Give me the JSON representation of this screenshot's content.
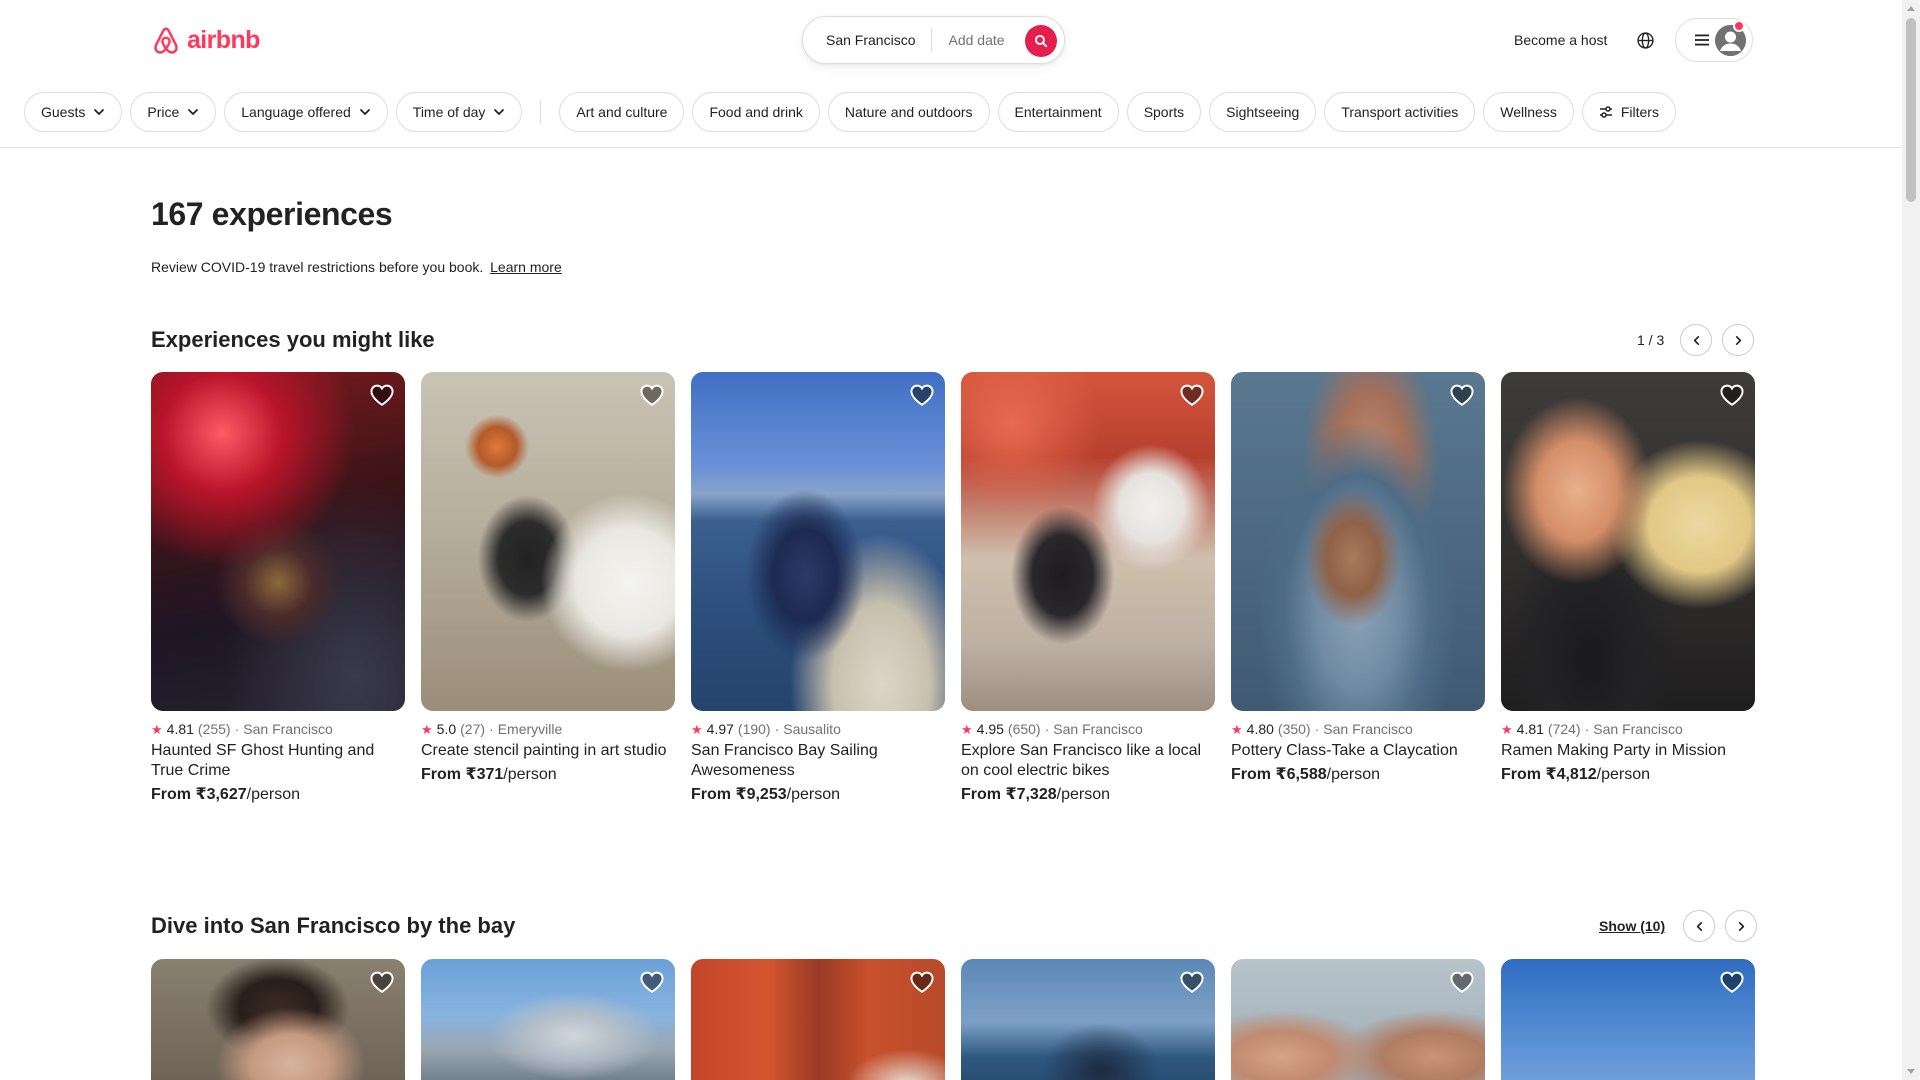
{
  "brand": {
    "name": "airbnb",
    "color": "#ff385c"
  },
  "search": {
    "location": "San Francisco",
    "date_placeholder": "Add date",
    "button_icon": "search-icon",
    "button_color": "#e61e4d"
  },
  "header_actions": {
    "host_label": "Become a host",
    "globe_icon": "globe-icon",
    "menu_icon": "hamburger-icon",
    "avatar_icon": "user-avatar-icon",
    "notification_color": "#ff385c"
  },
  "filters": {
    "dropdowns": [
      "Guests",
      "Price",
      "Language offered",
      "Time of day"
    ],
    "categories": [
      "Art and culture",
      "Food and drink",
      "Nature and outdoors",
      "Entertainment",
      "Sports",
      "Sightseeing",
      "Transport activities",
      "Wellness"
    ],
    "filters_label": "Filters"
  },
  "main": {
    "title": "167 experiences",
    "covid_notice": "Review COVID-19 travel restrictions before you book.",
    "covid_link": "Learn more"
  },
  "sections": [
    {
      "title": "Experiences you might like",
      "pager": "1 / 3",
      "cards": [
        {
          "rating": "4.81",
          "reviews": "(255)",
          "location": "San Francisco",
          "title": "Haunted SF Ghost Hunting and True Crime",
          "price_prefix": "From",
          "price": "₹3,627",
          "price_suffix": "/person"
        },
        {
          "rating": "5.0",
          "reviews": "(27)",
          "location": "Emeryville",
          "title": "Create stencil painting in art studio",
          "price_prefix": "From",
          "price": "₹371",
          "price_suffix": "/person"
        },
        {
          "rating": "4.97",
          "reviews": "(190)",
          "location": "Sausalito",
          "title": "San Francisco Bay Sailing Awesomeness",
          "price_prefix": "From",
          "price": "₹9,253",
          "price_suffix": "/person"
        },
        {
          "rating": "4.95",
          "reviews": "(650)",
          "location": "San Francisco",
          "title": "Explore San Francisco like a local on cool electric bikes",
          "price_prefix": "From",
          "price": "₹7,328",
          "price_suffix": "/person"
        },
        {
          "rating": "4.80",
          "reviews": "(350)",
          "location": "San Francisco",
          "title": "Pottery Class-Take a Claycation",
          "price_prefix": "From",
          "price": "₹6,588",
          "price_suffix": "/person"
        },
        {
          "rating": "4.81",
          "reviews": "(724)",
          "location": "San Francisco",
          "title": "Ramen Making Party in Mission",
          "price_prefix": "From",
          "price": "₹4,812",
          "price_suffix": "/person"
        }
      ]
    },
    {
      "title": "Dive into San Francisco by the bay",
      "show_link": "Show (10)"
    }
  ],
  "icons": {
    "star": "★"
  }
}
